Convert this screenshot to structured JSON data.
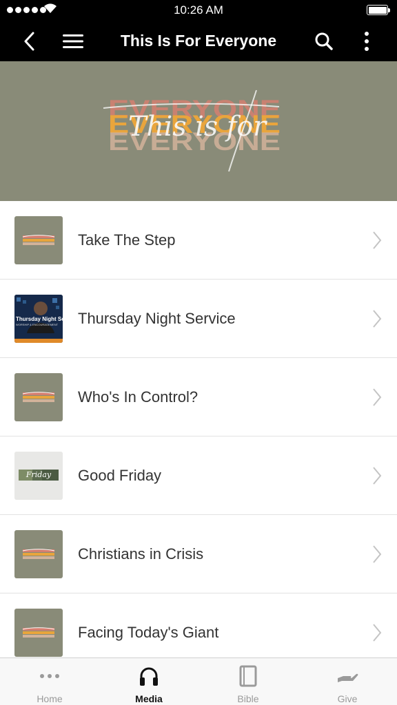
{
  "status_bar": {
    "time": "10:26 AM"
  },
  "nav": {
    "title": "This Is For Everyone"
  },
  "banner": {
    "block_text": "EVERYONE",
    "script_text": "This is for"
  },
  "list": [
    {
      "title": "Take The Step",
      "thumb": "series-art"
    },
    {
      "title": "Thursday Night Service",
      "thumb": "thursday",
      "thumb_text": "Thursday Night Service",
      "thumb_subtext": "WORSHIP & ENCOURAGEMENT"
    },
    {
      "title": "Who's In Control?",
      "thumb": "series-art"
    },
    {
      "title": "Good Friday",
      "thumb": "good-friday",
      "thumb_text": "Friday"
    },
    {
      "title": "Christians in Crisis",
      "thumb": "series-art"
    },
    {
      "title": "Facing Today's Giant",
      "thumb": "series-art"
    }
  ],
  "tabs": [
    {
      "label": "Home",
      "icon": "ellipsis-icon",
      "active": false
    },
    {
      "label": "Media",
      "icon": "headphones-icon",
      "active": true
    },
    {
      "label": "Bible",
      "icon": "book-icon",
      "active": false
    },
    {
      "label": "Give",
      "icon": "giving-hand-icon",
      "active": false
    }
  ],
  "colors": {
    "bar": "#000000",
    "banner_bg": "#898b78",
    "active_tab": "#111111",
    "inactive_tab": "#9a9a9a",
    "row_text": "#333333"
  }
}
